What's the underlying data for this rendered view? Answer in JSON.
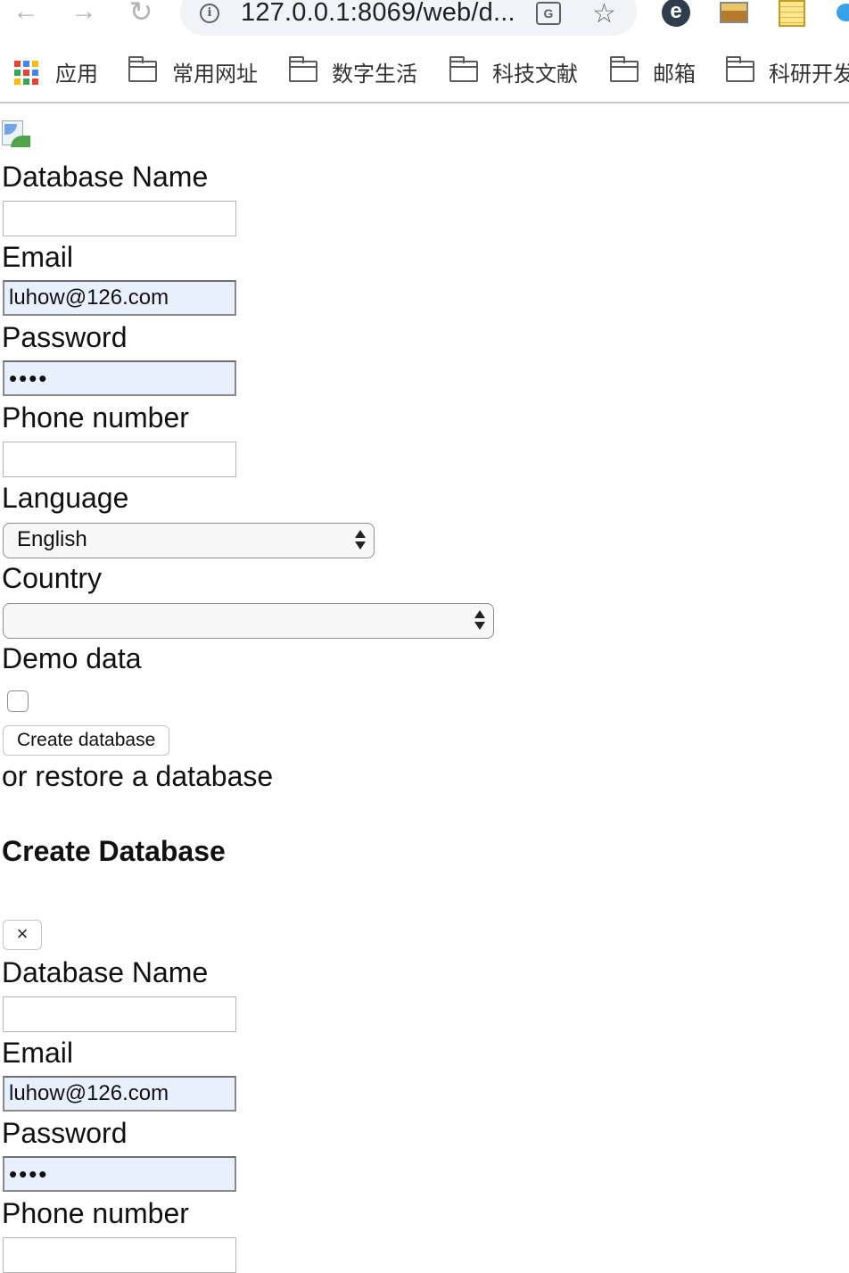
{
  "browser": {
    "url": "127.0.0.1:8069/web/d...",
    "bookmarks": [
      {
        "label": "应用"
      },
      {
        "label": "常用网址"
      },
      {
        "label": "数字生活"
      },
      {
        "label": "科技文献"
      },
      {
        "label": "邮箱"
      },
      {
        "label": "科研开发"
      }
    ]
  },
  "form1": {
    "database_name_label": "Database Name",
    "database_name_value": "",
    "email_label": "Email",
    "email_value": "luhow@126.com",
    "password_label": "Password",
    "password_masked": "••••",
    "phone_label": "Phone number",
    "phone_value": "",
    "language_label": "Language",
    "language_value": "English",
    "country_label": "Country",
    "country_value": "",
    "demo_data_label": "Demo data",
    "demo_data_checked": false,
    "create_button": "Create database",
    "restore_text": "or restore a database"
  },
  "modal": {
    "title": "Create Database",
    "close_symbol": "×",
    "database_name_label": "Database Name",
    "database_name_value": "",
    "email_label": "Email",
    "email_value": "luhow@126.com",
    "password_label": "Password",
    "password_masked": "••••",
    "phone_label": "Phone number",
    "phone_value": ""
  },
  "colors": {
    "autofill_bg": "#e8f0fe",
    "omnibox_bg": "#f1f3f4"
  },
  "icons": {
    "back": "arrow-left-icon",
    "forward": "arrow-right-icon",
    "reload": "reload-icon",
    "site_info": "info-icon",
    "translate": "translate-icon",
    "bookmark_star": "star-icon",
    "apps": "apps-grid-icon",
    "folder": "folder-icon",
    "broken_image": "broken-image-icon"
  }
}
